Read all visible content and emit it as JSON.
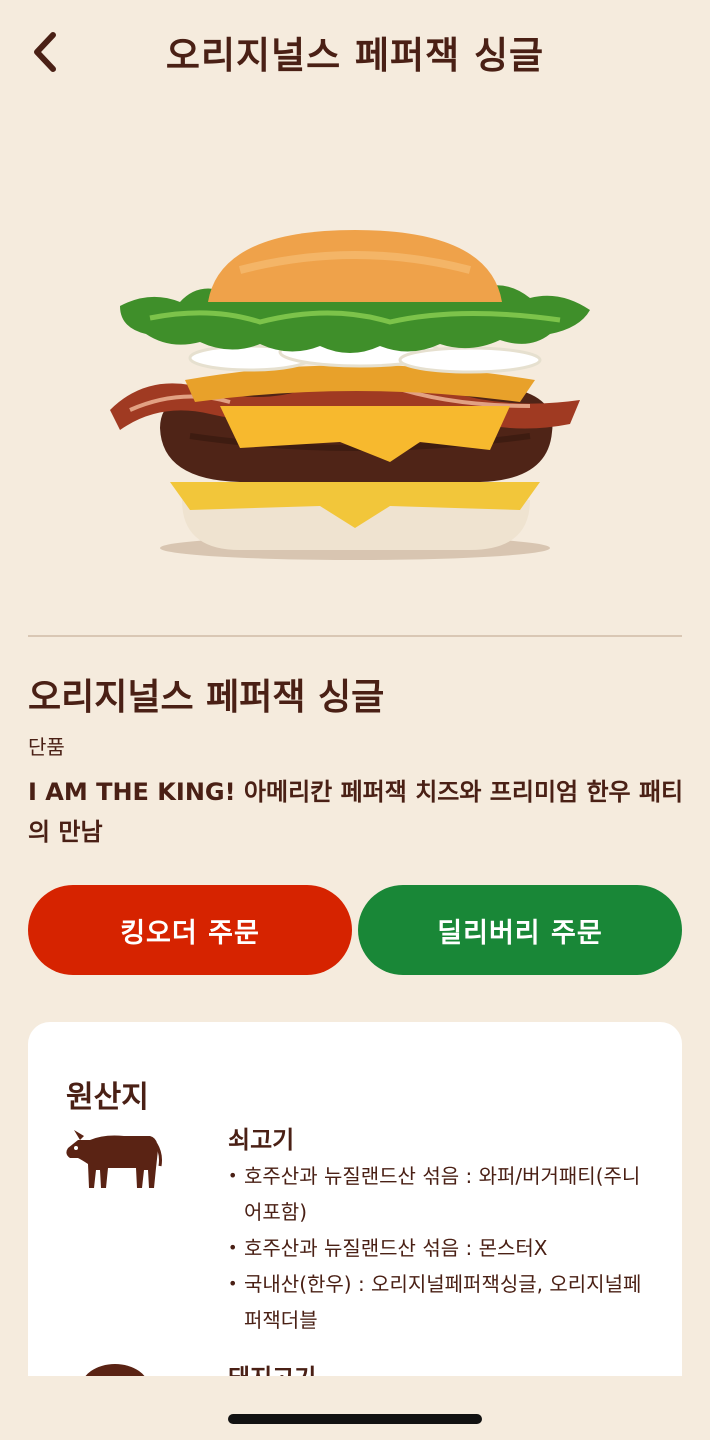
{
  "header": {
    "title": "오리지널스 페퍼잭 싱글",
    "back_icon": "chevron-left-icon"
  },
  "product": {
    "name": "오리지널스 페퍼잭 싱글",
    "type": "단품",
    "description": "I AM THE KING! 아메리칸 페퍼잭 치즈와 프리미엄 한우 패티의 만남"
  },
  "buttons": {
    "king_order": "킹오더 주문",
    "delivery_order": "딜리버리 주문"
  },
  "origin": {
    "heading": "원산지",
    "items": [
      {
        "icon": "cow-icon",
        "title": "쇠고기",
        "lines": [
          "호주산과 뉴질랜드산 섞음 : 와퍼/버거패티(주니어포함)",
          "호주산과 뉴질랜드산 섞음 : 몬스터X",
          "국내산(한우) : 오리지널페퍼잭싱글, 오리지널페퍼잭더블"
        ]
      },
      {
        "icon": "pig-icon",
        "title": "돼지고기"
      }
    ]
  },
  "colors": {
    "background": "#f5ebdd",
    "brown": "#4a2015",
    "king_order_red": "#d62300",
    "delivery_green": "#198737"
  }
}
